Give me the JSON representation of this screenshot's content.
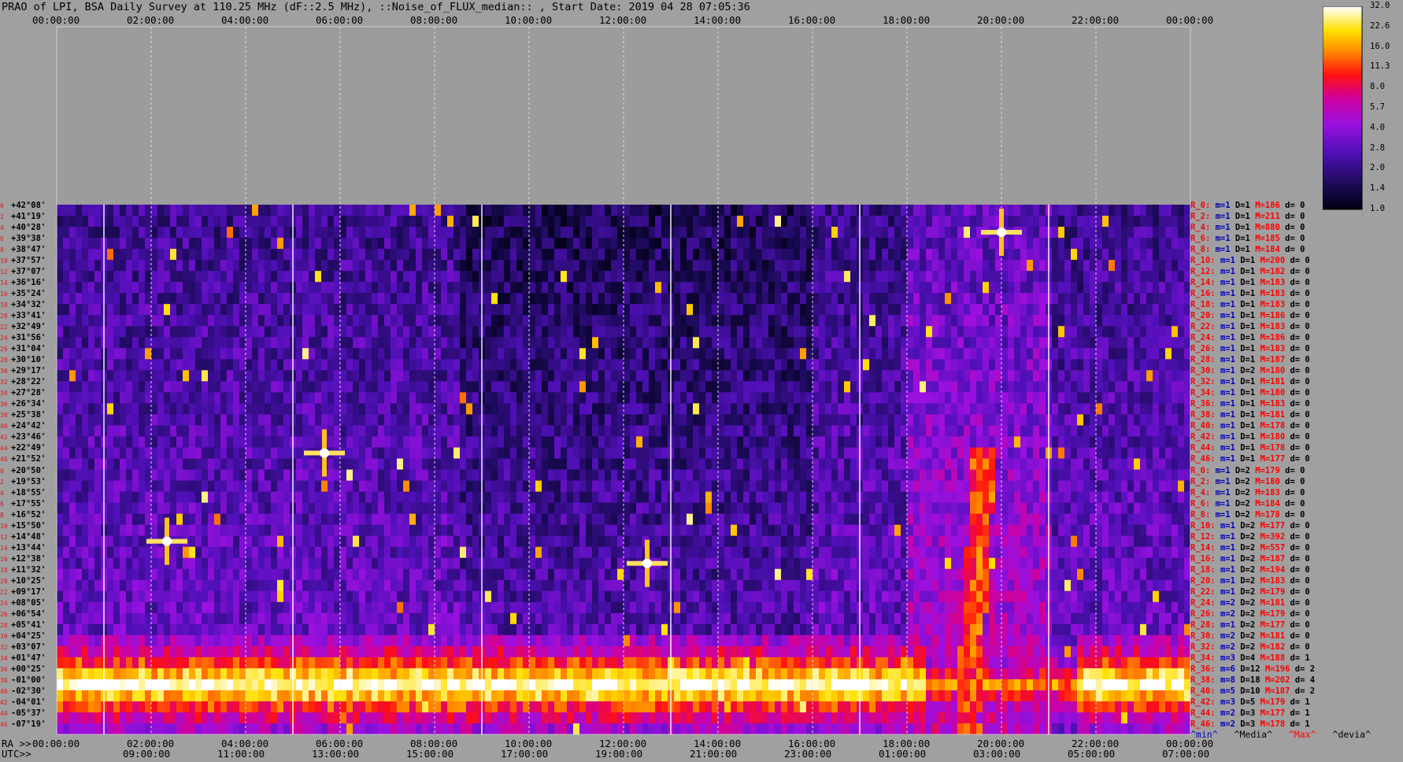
{
  "title": "PRAO of LPI, BSA Daily Survey at 110.25 MHz (dF::2.5 MHz), ::Noise_of_FLUX_median:: , Start Date: 2019 04 28 07:05:36",
  "chart_data": {
    "type": "heatmap",
    "title": "PRAO of LPI, BSA Daily Survey at 110.25 MHz (dF::2.5 MHz), ::Noise_of_FLUX_median:: , Start Date: 2019 04 28 07:05:36",
    "top_axis_ticks": [
      "00:00:00",
      "02:00:00",
      "04:00:00",
      "06:00:00",
      "08:00:00",
      "10:00:00",
      "12:00:00",
      "14:00:00",
      "16:00:00",
      "18:00:00",
      "20:00:00",
      "22:00:00",
      "00:00:00"
    ],
    "ra_axis_label": "RA >>",
    "ra_ticks": [
      "00:00:00",
      "02:00:00",
      "04:00:00",
      "06:00:00",
      "08:00:00",
      "10:00:00",
      "12:00:00",
      "14:00:00",
      "16:00:00",
      "18:00:00",
      "20:00:00",
      "22:00:00",
      "00:00:00"
    ],
    "utc_axis_label": "UTC>>",
    "utc_ticks": [
      "09:00:00",
      "11:00:00",
      "13:00:00",
      "15:00:00",
      "17:00:00",
      "19:00:00",
      "21:00:00",
      "23:00:00",
      "01:00:00",
      "03:00:00",
      "05:00:00",
      "07:00:00"
    ],
    "colorbar_ticks": [
      "32.0",
      "22.6",
      "16.0",
      "11.3",
      "8.0",
      "5.7",
      "4.0",
      "2.8",
      "2.0",
      "1.4",
      "1.0"
    ],
    "colorbar_min": 1.0,
    "colorbar_max": 32.0,
    "colorbar_scale": "log",
    "declinations": [
      "+42°08'",
      "+41°19'",
      "+40°28'",
      "+39°38'",
      "+38°47'",
      "+37°57'",
      "+37°07'",
      "+36°16'",
      "+35°24'",
      "+34°32'",
      "+33°41'",
      "+32°49'",
      "+31°56'",
      "+31°04'",
      "+30°10'",
      "+29°17'",
      "+28°22'",
      "+27°28'",
      "+26°34'",
      "+25°38'",
      "+24°42'",
      "+23°46'",
      "+22°49'",
      "+21°52'",
      "+20°50'",
      "+19°53'",
      "+18°55'",
      "+17°55'",
      "+16°52'",
      "+15°50'",
      "+14°48'",
      "+13°44'",
      "+12°38'",
      "+11°32'",
      "+10°25'",
      "+09°17'",
      "+08°05'",
      "+06°54'",
      "+05°41'",
      "+04°25'",
      "+03°07'",
      "+01°47'",
      "+00°25'",
      "-01°00'",
      "-02°30'",
      "-04°01'",
      "-05°37'",
      "-07°19'"
    ],
    "row_indices": [
      "0",
      "2",
      "4",
      "6",
      "8",
      "10",
      "12",
      "14",
      "16",
      "18",
      "20",
      "22",
      "24",
      "26",
      "28",
      "30",
      "32",
      "34",
      "36",
      "38",
      "40",
      "42",
      "44",
      "46",
      "0",
      "2",
      "4",
      "6",
      "8",
      "10",
      "12",
      "14",
      "16",
      "18",
      "20",
      "22",
      "24",
      "26",
      "28",
      "30",
      "32",
      "34",
      "36",
      "38",
      "40",
      "42",
      "44",
      "46"
    ],
    "row_stats": [
      {
        "r": "R_0:",
        "m": "m=1",
        "D": "D=1",
        "M": "M=186",
        "d": "d= 0"
      },
      {
        "r": "R_2:",
        "m": "m=1",
        "D": "D=1",
        "M": "M=211",
        "d": "d= 0"
      },
      {
        "r": "R_4:",
        "m": "m=1",
        "D": "D=1",
        "M": "M=880",
        "d": "d= 0"
      },
      {
        "r": "R_6:",
        "m": "m=1",
        "D": "D=1",
        "M": "M=185",
        "d": "d= 0"
      },
      {
        "r": "R_8:",
        "m": "m=1",
        "D": "D=1",
        "M": "M=184",
        "d": "d= 0"
      },
      {
        "r": "R_10:",
        "m": "m=1",
        "D": "D=1",
        "M": "M=200",
        "d": "d= 0"
      },
      {
        "r": "R_12:",
        "m": "m=1",
        "D": "D=1",
        "M": "M=182",
        "d": "d= 0"
      },
      {
        "r": "R_14:",
        "m": "m=1",
        "D": "D=1",
        "M": "M=183",
        "d": "d= 0"
      },
      {
        "r": "R_16:",
        "m": "m=1",
        "D": "D=1",
        "M": "M=183",
        "d": "d= 0"
      },
      {
        "r": "R_18:",
        "m": "m=1",
        "D": "D=1",
        "M": "M=183",
        "d": "d= 0"
      },
      {
        "r": "R_20:",
        "m": "m=1",
        "D": "D=1",
        "M": "M=186",
        "d": "d= 0"
      },
      {
        "r": "R_22:",
        "m": "m=1",
        "D": "D=1",
        "M": "M=183",
        "d": "d= 0"
      },
      {
        "r": "R_24:",
        "m": "m=1",
        "D": "D=1",
        "M": "M=186",
        "d": "d= 0"
      },
      {
        "r": "R_26:",
        "m": "m=1",
        "D": "D=1",
        "M": "M=183",
        "d": "d= 0"
      },
      {
        "r": "R_28:",
        "m": "m=1",
        "D": "D=1",
        "M": "M=187",
        "d": "d= 0"
      },
      {
        "r": "R_30:",
        "m": "m=1",
        "D": "D=2",
        "M": "M=180",
        "d": "d= 0"
      },
      {
        "r": "R_32:",
        "m": "m=1",
        "D": "D=1",
        "M": "M=181",
        "d": "d= 0"
      },
      {
        "r": "R_34:",
        "m": "m=1",
        "D": "D=1",
        "M": "M=180",
        "d": "d= 0"
      },
      {
        "r": "R_36:",
        "m": "m=1",
        "D": "D=1",
        "M": "M=183",
        "d": "d= 0"
      },
      {
        "r": "R_38:",
        "m": "m=1",
        "D": "D=1",
        "M": "M=181",
        "d": "d= 0"
      },
      {
        "r": "R_40:",
        "m": "m=1",
        "D": "D=1",
        "M": "M=178",
        "d": "d= 0"
      },
      {
        "r": "R_42:",
        "m": "m=1",
        "D": "D=1",
        "M": "M=180",
        "d": "d= 0"
      },
      {
        "r": "R_44:",
        "m": "m=1",
        "D": "D=1",
        "M": "M=178",
        "d": "d= 0"
      },
      {
        "r": "R_46:",
        "m": "m=1",
        "D": "D=1",
        "M": "M=177",
        "d": "d= 0"
      },
      {
        "r": "R_0:",
        "m": "m=1",
        "D": "D=2",
        "M": "M=179",
        "d": "d= 0"
      },
      {
        "r": "R_2:",
        "m": "m=1",
        "D": "D=2",
        "M": "M=180",
        "d": "d= 0"
      },
      {
        "r": "R_4:",
        "m": "m=1",
        "D": "D=2",
        "M": "M=183",
        "d": "d= 0"
      },
      {
        "r": "R_6:",
        "m": "m=1",
        "D": "D=2",
        "M": "M=184",
        "d": "d= 0"
      },
      {
        "r": "R_8:",
        "m": "m=1",
        "D": "D=2",
        "M": "M=178",
        "d": "d= 0"
      },
      {
        "r": "R_10:",
        "m": "m=1",
        "D": "D=2",
        "M": "M=177",
        "d": "d= 0"
      },
      {
        "r": "R_12:",
        "m": "m=1",
        "D": "D=2",
        "M": "M=392",
        "d": "d= 0"
      },
      {
        "r": "R_14:",
        "m": "m=1",
        "D": "D=2",
        "M": "M=557",
        "d": "d= 0"
      },
      {
        "r": "R_16:",
        "m": "m=1",
        "D": "D=2",
        "M": "M=187",
        "d": "d= 0"
      },
      {
        "r": "R_18:",
        "m": "m=1",
        "D": "D=2",
        "M": "M=194",
        "d": "d= 0"
      },
      {
        "r": "R_20:",
        "m": "m=1",
        "D": "D=2",
        "M": "M=183",
        "d": "d= 0"
      },
      {
        "r": "R_22:",
        "m": "m=1",
        "D": "D=2",
        "M": "M=179",
        "d": "d= 0"
      },
      {
        "r": "R_24:",
        "m": "m=2",
        "D": "D=2",
        "M": "M=181",
        "d": "d= 0"
      },
      {
        "r": "R_26:",
        "m": "m=2",
        "D": "D=2",
        "M": "M=179",
        "d": "d= 0"
      },
      {
        "r": "R_28:",
        "m": "m=1",
        "D": "D=2",
        "M": "M=177",
        "d": "d= 0"
      },
      {
        "r": "R_30:",
        "m": "m=2",
        "D": "D=2",
        "M": "M=181",
        "d": "d= 0"
      },
      {
        "r": "R_32:",
        "m": "m=2",
        "D": "D=2",
        "M": "M=182",
        "d": "d= 0"
      },
      {
        "r": "R_34:",
        "m": "m=3",
        "D": "D=4",
        "M": "M=188",
        "d": "d= 1"
      },
      {
        "r": "R_36:",
        "m": "m=6",
        "D": "D=12",
        "M": "M=196",
        "d": "d= 2"
      },
      {
        "r": "R_38:",
        "m": "m=8",
        "D": "D=18",
        "M": "M=202",
        "d": "d= 4"
      },
      {
        "r": "R_40:",
        "m": "m=5",
        "D": "D=10",
        "M": "M=187",
        "d": "d= 2"
      },
      {
        "r": "R_42:",
        "m": "m=3",
        "D": "D=5",
        "M": "M=179",
        "d": "d= 1"
      },
      {
        "r": "R_44:",
        "m": "m=2",
        "D": "D=3",
        "M": "M=177",
        "d": "d= 1"
      },
      {
        "r": "R_46:",
        "m": "m=2",
        "D": "D=3",
        "M": "M=178",
        "d": "d= 1"
      }
    ],
    "stats_legend": {
      "min": "^min^",
      "median": "^Media^",
      "max": "^Max^",
      "dev": "^devia^"
    },
    "bright_sources": [
      {
        "ra": "02:20:00",
        "dec": "+14°48'"
      },
      {
        "ra": "20:00:00",
        "dec": "+40°28'"
      },
      {
        "ra": "05:40:00",
        "dec": "+22°49'"
      },
      {
        "ra": "12:30:00",
        "dec": "+12°38'"
      }
    ],
    "band_peak_dec": "-01°00'",
    "band_peak_value_range": [
      8,
      32
    ]
  }
}
